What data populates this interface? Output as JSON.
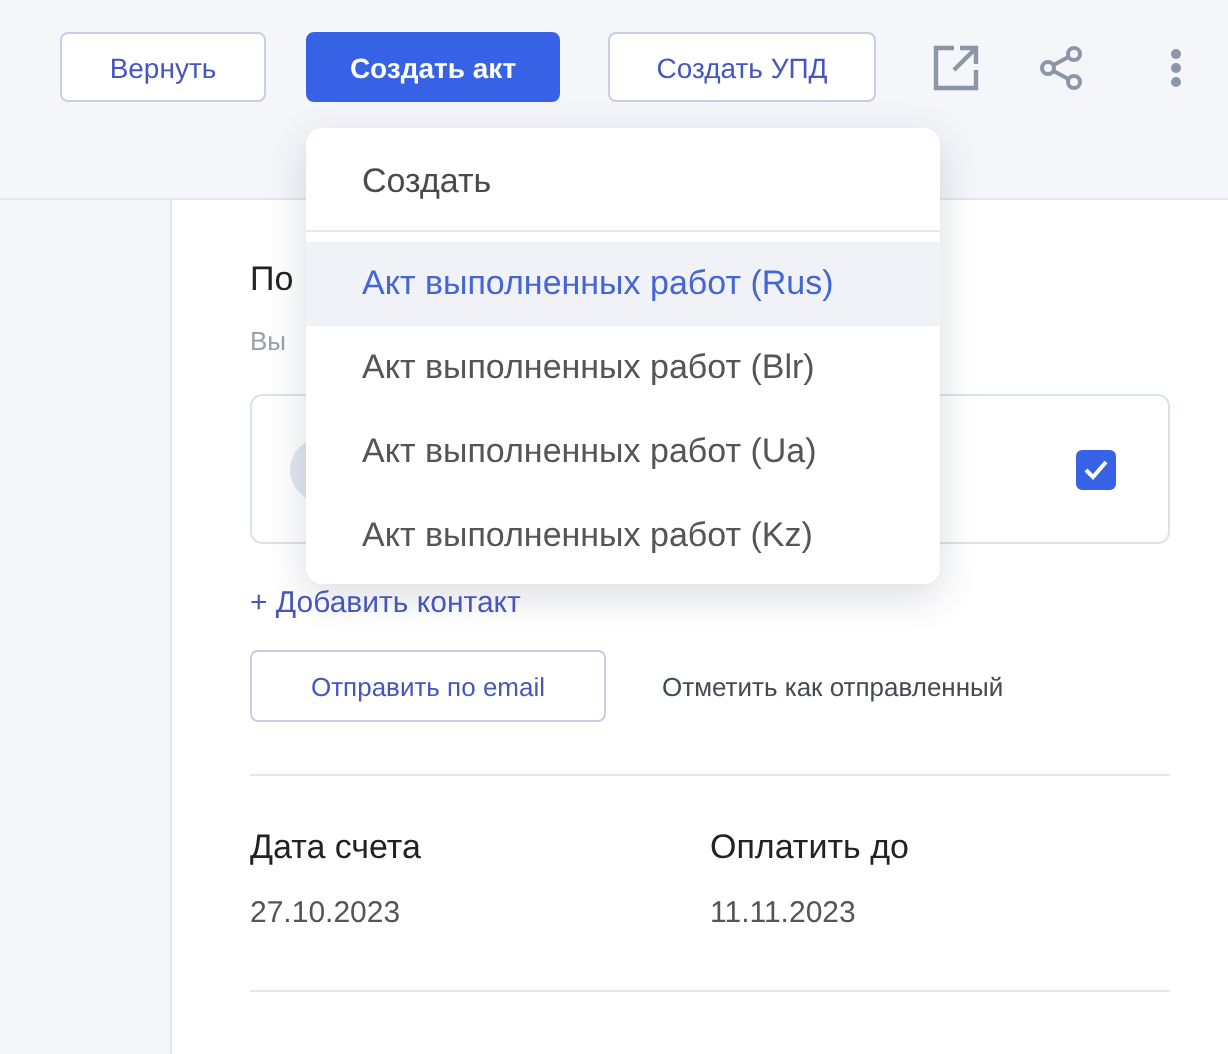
{
  "toolbar": {
    "buttons": [
      {
        "label": "Вернуть",
        "kind": "outline"
      },
      {
        "label": "Создать акт",
        "kind": "primary"
      },
      {
        "label": "Создать УПД",
        "kind": "outline"
      }
    ]
  },
  "dropdown": {
    "header": "Создать",
    "items": [
      {
        "label": "Акт выполненных работ (Rus)",
        "selected": true
      },
      {
        "label": "Акт выполненных работ (Blr)",
        "selected": false
      },
      {
        "label": "Акт выполненных работ (Ua)",
        "selected": false
      },
      {
        "label": "Акт выполненных работ (Kz)",
        "selected": false
      }
    ]
  },
  "recipients": {
    "heading": "По",
    "hint": "Вы",
    "contact": {
      "checked": true
    },
    "add_link": "+ Добавить контакт"
  },
  "actions": [
    {
      "label": "Отправить по email",
      "kind": "outline"
    },
    {
      "label": "Отметить как отправленный",
      "kind": "text"
    }
  ],
  "dates": [
    {
      "label": "Дата счета",
      "value": "27.10.2023"
    },
    {
      "label": "Оплатить до",
      "value": "11.11.2023"
    }
  ]
}
